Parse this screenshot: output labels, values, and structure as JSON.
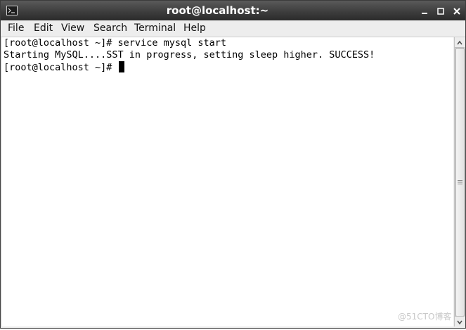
{
  "window": {
    "title": "root@localhost:~"
  },
  "menu": [
    "File",
    "Edit",
    "View",
    "Search",
    "Terminal",
    "Help"
  ],
  "terminal": {
    "lines": [
      "[root@localhost ~]# service mysql start",
      "Starting MySQL....SST in progress, setting sleep higher. SUCCESS!",
      "[root@localhost ~]# "
    ]
  },
  "watermark": "@51CTO博客",
  "icons": {
    "app": "terminal-app-icon",
    "minimize": "minimize-icon",
    "maximize": "maximize-icon",
    "close": "close-icon",
    "scroll_up": "chevron-up-icon",
    "scroll_down": "chevron-down-icon"
  },
  "colors": {
    "titlebar": "#3e3e3e",
    "terminal_bg": "#ffffff",
    "terminal_fg": "#000000"
  }
}
